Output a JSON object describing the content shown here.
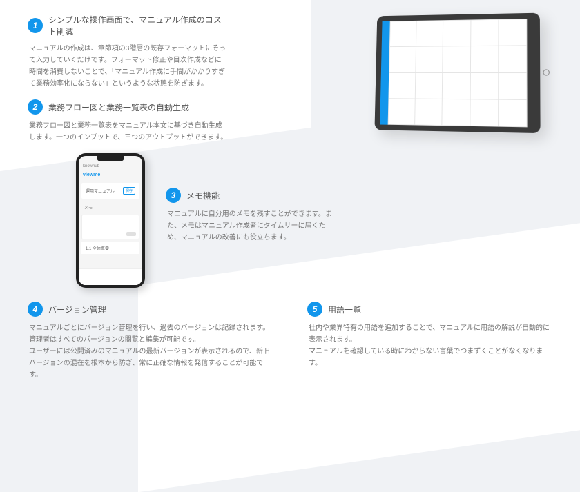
{
  "features": {
    "f1": {
      "num": "1",
      "title": "シンプルな操作画面で、マニュアル作成のコスト削減",
      "body": "マニュアルの作成は、章節項の3階層の既存フォーマットにそって入力していくだけです。フォーマット修正や目次作成などに時間を消費しないことで、「マニュアル作成に手間がかかりすぎて業務効率化にならない」というような状態を防ぎます。"
    },
    "f2": {
      "num": "2",
      "title": "業務フロー図と業務一覧表の自動生成",
      "body": "業務フロー図と業務一覧表をマニュアル本文に基づき自動生成します。一つのインプットで、三つのアウトプットができます。"
    },
    "f3": {
      "num": "3",
      "title": "メモ機能",
      "body": "マニュアルに自分用のメモを残すことができます。また、メモはマニュアル作成者にタイムリーに届くため、マニュアルの改善にも役立ちます。"
    },
    "f4": {
      "num": "4",
      "title": "バージョン管理",
      "body": "マニュアルごとにバージョン管理を行い、過去のバージョンは記録されます。管理者はすべてのバージョンの閲覧と編集が可能です。\nユーザーには公開済みのマニュアルの最新バージョンが表示されるので、新旧バージョンの混在を根本から防ぎ、常に正確な情報を発信することが可能です。"
    },
    "f5": {
      "num": "5",
      "title": "用語一覧",
      "body": "社内や業界特有の用語を追加することで、マニュアルに用語の解説が自動的に表示されます。\nマニュアルを確認している時にわからない言葉でつまずくことがなくなります。"
    }
  },
  "phone": {
    "header": "knowhub",
    "app": "viewme",
    "manual_label": "運用マニュアル",
    "save_btn": "保存",
    "memo_label": "メモ",
    "item": "1.1 全体概要"
  }
}
